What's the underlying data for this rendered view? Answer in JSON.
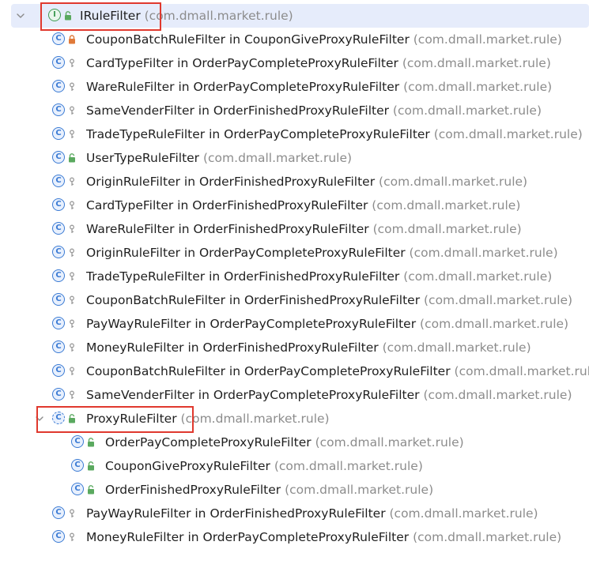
{
  "tree": {
    "root": {
      "name": "IRuleFilter",
      "pkg": "(com.dmall.market.rule)",
      "kind": "interface",
      "vis": "public",
      "expanded": true
    },
    "items": [
      {
        "name": "CouponBatchRuleFilter in CouponGiveProxyRuleFilter",
        "pkg": "(com.dmall.market.rule)",
        "vis": "private"
      },
      {
        "name": "CardTypeFilter in OrderPayCompleteProxyRuleFilter",
        "pkg": "(com.dmall.market.rule)",
        "vis": "package"
      },
      {
        "name": "WareRuleFilter in OrderPayCompleteProxyRuleFilter",
        "pkg": "(com.dmall.market.rule)",
        "vis": "package"
      },
      {
        "name": "SameVenderFilter in OrderFinishedProxyRuleFilter",
        "pkg": "(com.dmall.market.rule)",
        "vis": "package"
      },
      {
        "name": "TradeTypeRuleFilter in OrderPayCompleteProxyRuleFilter",
        "pkg": "(com.dmall.market.rule)",
        "vis": "package"
      },
      {
        "name": "UserTypeRuleFilter",
        "pkg": "(com.dmall.market.rule)",
        "vis": "public"
      },
      {
        "name": "OriginRuleFilter in OrderFinishedProxyRuleFilter",
        "pkg": "(com.dmall.market.rule)",
        "vis": "package"
      },
      {
        "name": "CardTypeFilter in OrderFinishedProxyRuleFilter",
        "pkg": "(com.dmall.market.rule)",
        "vis": "package"
      },
      {
        "name": "WareRuleFilter in OrderFinishedProxyRuleFilter",
        "pkg": "(com.dmall.market.rule)",
        "vis": "package"
      },
      {
        "name": "OriginRuleFilter in OrderPayCompleteProxyRuleFilter",
        "pkg": "(com.dmall.market.rule)",
        "vis": "package"
      },
      {
        "name": "TradeTypeRuleFilter in OrderFinishedProxyRuleFilter",
        "pkg": "(com.dmall.market.rule)",
        "vis": "package"
      },
      {
        "name": "CouponBatchRuleFilter in OrderFinishedProxyRuleFilter",
        "pkg": "(com.dmall.market.rule)",
        "vis": "package"
      },
      {
        "name": "PayWayRuleFilter in OrderPayCompleteProxyRuleFilter",
        "pkg": "(com.dmall.market.rule)",
        "vis": "package"
      },
      {
        "name": "MoneyRuleFilter in OrderFinishedProxyRuleFilter",
        "pkg": "(com.dmall.market.rule)",
        "vis": "package"
      },
      {
        "name": "CouponBatchRuleFilter in OrderPayCompleteProxyRuleFilter",
        "pkg": "(com.dmall.market.rule)",
        "vis": "package"
      },
      {
        "name": "SameVenderFilter in OrderPayCompleteProxyRuleFilter",
        "pkg": "(com.dmall.market.rule)",
        "vis": "package"
      },
      {
        "name": "ProxyRuleFilter",
        "pkg": "(com.dmall.market.rule)",
        "vis": "public",
        "kind": "abstract",
        "expanded": true
      },
      {
        "name": "OrderPayCompleteProxyRuleFilter",
        "pkg": "(com.dmall.market.rule)",
        "vis": "public",
        "child": true
      },
      {
        "name": "CouponGiveProxyRuleFilter",
        "pkg": "(com.dmall.market.rule)",
        "vis": "public",
        "child": true
      },
      {
        "name": "OrderFinishedProxyRuleFilter",
        "pkg": "(com.dmall.market.rule)",
        "vis": "public",
        "child": true
      },
      {
        "name": "PayWayRuleFilter in OrderFinishedProxyRuleFilter",
        "pkg": "(com.dmall.market.rule)",
        "vis": "package"
      },
      {
        "name": "MoneyRuleFilter in OrderPayCompleteProxyRuleFilter",
        "pkg": "(com.dmall.market.rule)",
        "vis": "package"
      }
    ]
  },
  "icons": {
    "interface": "interface-icon",
    "class": "class-icon",
    "abstract": "abstract-class-icon",
    "public": "public-lock-icon",
    "private": "private-lock-icon",
    "package": "package-key-icon",
    "chevron": "chevron-down-icon"
  },
  "colors": {
    "selection": "#e6ecfb",
    "highlight_box": "#e0392e",
    "class_icon": "#3b7bd4",
    "interface_icon": "#3f9b54",
    "private": "#e07a3a",
    "public": "#5aa95f",
    "package": "#9a9a9a",
    "pkg_text": "#8c8c8c"
  }
}
